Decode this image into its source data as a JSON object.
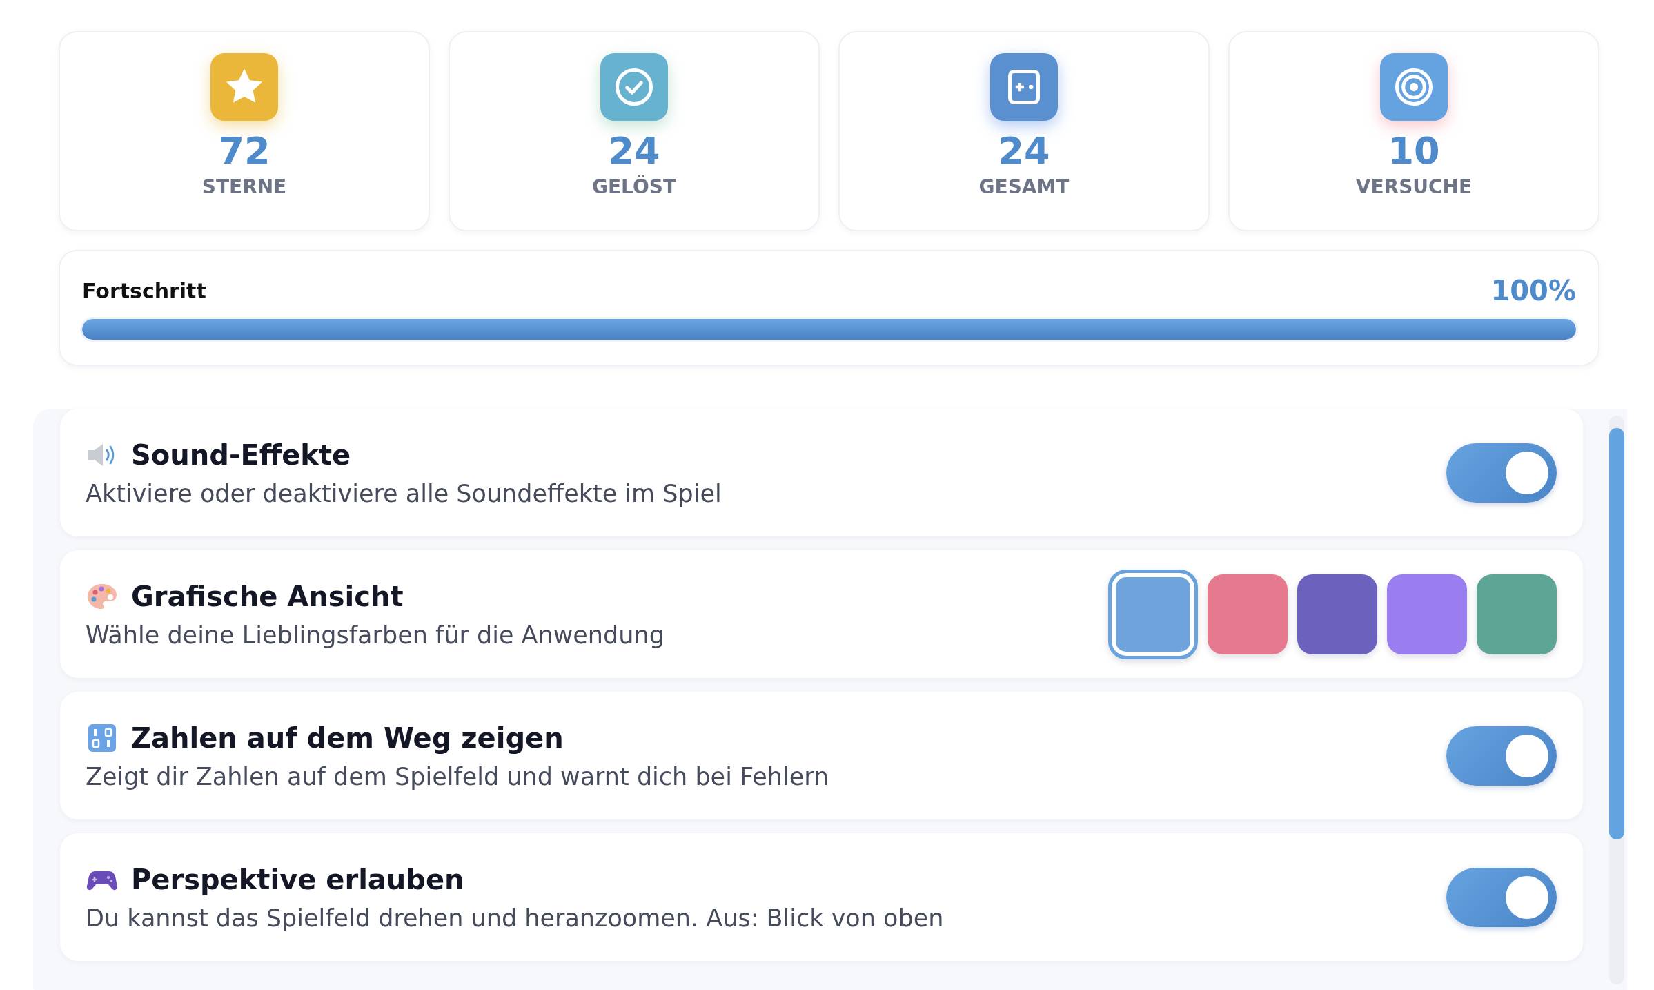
{
  "stats": [
    {
      "kind": "star",
      "value": "72",
      "label": "STERNE"
    },
    {
      "kind": "check",
      "value": "24",
      "label": "GELÖST"
    },
    {
      "kind": "puzzle",
      "value": "24",
      "label": "GESAMT"
    },
    {
      "kind": "target",
      "value": "10",
      "label": "VERSUCHE"
    }
  ],
  "progress": {
    "label": "Fortschritt",
    "percent": "100%",
    "level": 1
  },
  "settings": [
    {
      "kind": "toggle",
      "title": "Sound-Effekte",
      "description": "Aktiviere oder deaktiviere alle Soundeffekte im Spiel",
      "on": true
    },
    {
      "kind": "swatches",
      "title": "Grafische Ansicht",
      "description": "Wähle deine Lieblingsfarben für die Anwendung",
      "swatches": [
        {
          "color": "#6fa3dc",
          "selected": true
        },
        {
          "color": "#e57a8e",
          "selected": false
        },
        {
          "color": "#6b62bd",
          "selected": false
        },
        {
          "color": "#9a7ef0",
          "selected": false
        },
        {
          "color": "#5fa596",
          "selected": false
        }
      ]
    },
    {
      "kind": "toggle",
      "title": "Zahlen auf dem Weg zeigen",
      "description": "Zeigt dir Zahlen auf dem Spielfeld und warnt dich bei Fehlern",
      "on": true
    },
    {
      "kind": "toggle",
      "title": "Perspektive erlauben",
      "description": "Du kannst das Spielfeld drehen und heranzoomen. Aus: Blick von oben",
      "on": true
    }
  ]
}
